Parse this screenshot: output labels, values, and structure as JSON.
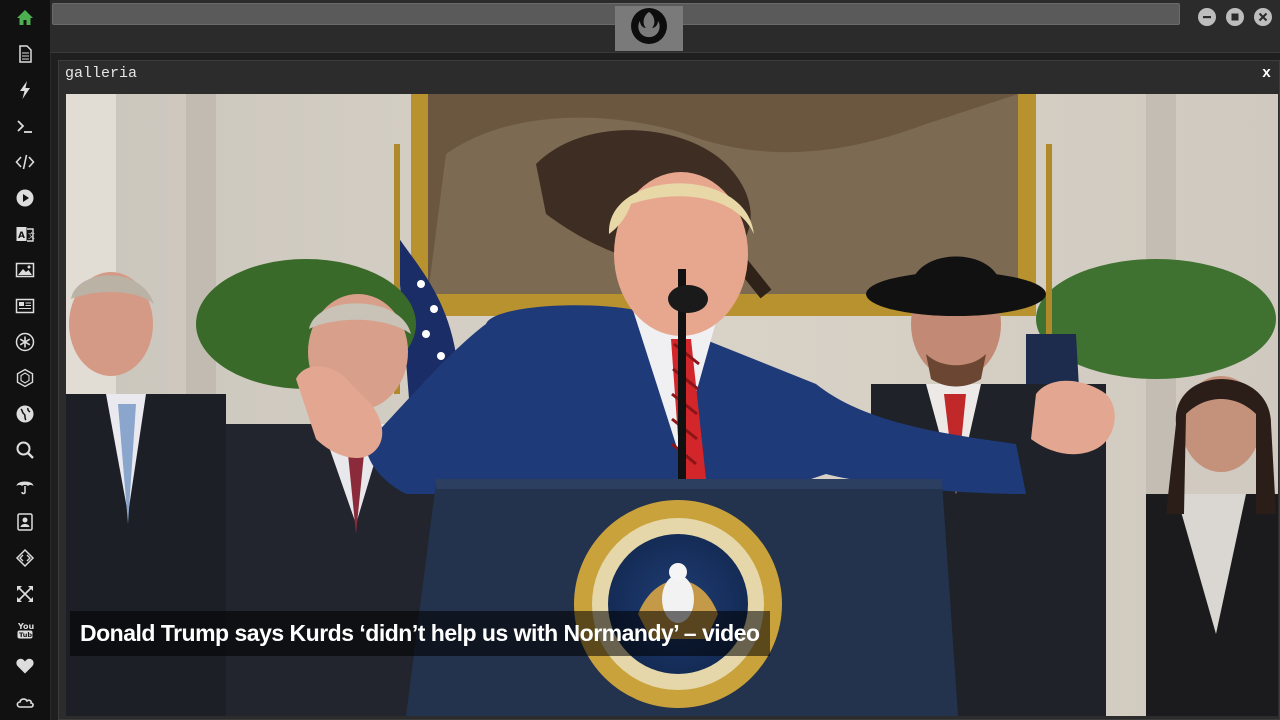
{
  "window": {
    "app_logo": "rebel-alliance-logo",
    "controls": [
      "minimize-icon",
      "maximize-icon",
      "close-icon"
    ]
  },
  "sidebar": {
    "accent_color": "#4caf50",
    "items": [
      {
        "icon": "home-icon",
        "active": true
      },
      {
        "icon": "document-icon"
      },
      {
        "icon": "lightning-icon"
      },
      {
        "icon": "terminal-icon"
      },
      {
        "icon": "code-icon"
      },
      {
        "icon": "play-icon"
      },
      {
        "icon": "translate-icon"
      },
      {
        "icon": "image-icon"
      },
      {
        "icon": "news-icon"
      },
      {
        "icon": "asterisk-icon"
      },
      {
        "icon": "hexagon-icon"
      },
      {
        "icon": "globe-icon"
      },
      {
        "icon": "search-icon"
      },
      {
        "icon": "umbrella-icon"
      },
      {
        "icon": "contact-icon"
      },
      {
        "icon": "diamond-code-icon"
      },
      {
        "icon": "expand-icon"
      },
      {
        "icon": "youtube-icon"
      },
      {
        "icon": "heart-icon"
      },
      {
        "icon": "cloud-icon"
      }
    ]
  },
  "panel": {
    "title": "galleria",
    "close_label": "x",
    "caption": "Donald Trump says Kurds ‘didn’t help us with Normandy’ – video"
  }
}
